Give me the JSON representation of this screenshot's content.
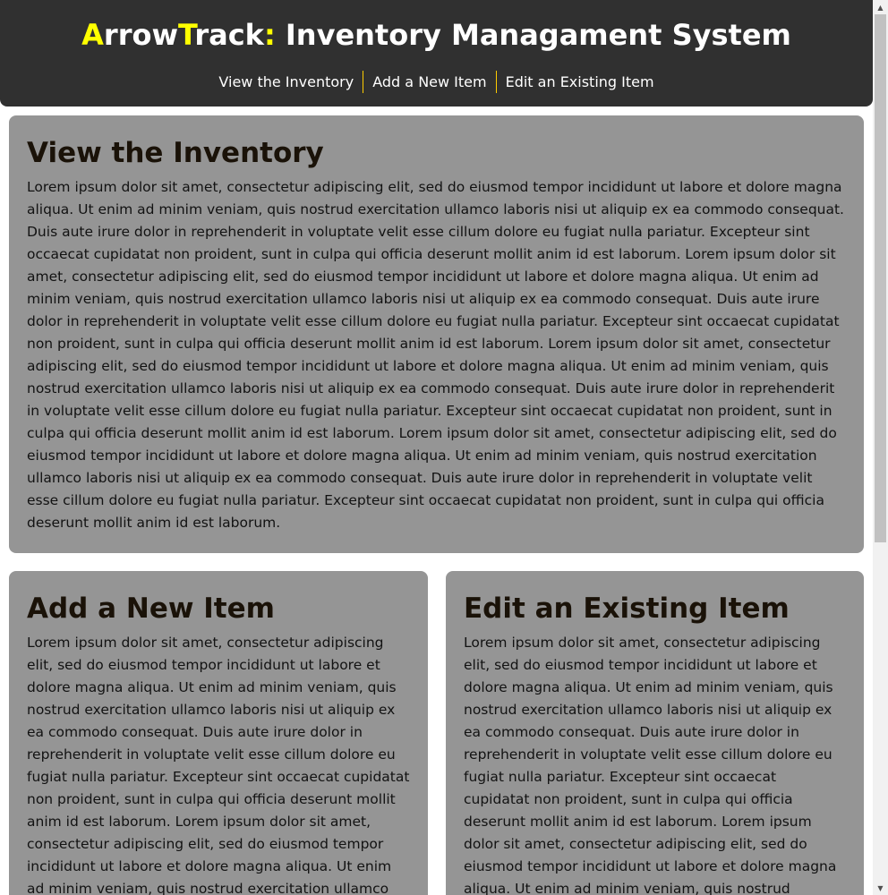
{
  "header": {
    "title_parts": [
      {
        "text": "A",
        "accent": true
      },
      {
        "text": "rrow",
        "accent": false
      },
      {
        "text": "T",
        "accent": true
      },
      {
        "text": "rack",
        "accent": false
      },
      {
        "text": ":",
        "accent": true
      },
      {
        "text": " Inventory Managament System",
        "accent": false
      }
    ],
    "nav": [
      {
        "label": "View the Inventory"
      },
      {
        "label": "Add a New Item"
      },
      {
        "label": "Edit an Existing Item"
      }
    ]
  },
  "sections": {
    "view": {
      "heading": "View the Inventory",
      "body": "Lorem ipsum dolor sit amet, consectetur adipiscing elit, sed do eiusmod tempor incididunt ut labore et dolore magna aliqua. Ut enim ad minim veniam, quis nostrud exercitation ullamco laboris nisi ut aliquip ex ea commodo consequat. Duis aute irure dolor in reprehenderit in voluptate velit esse cillum dolore eu fugiat nulla pariatur. Excepteur sint occaecat cupidatat non proident, sunt in culpa qui officia deserunt mollit anim id est laborum. Lorem ipsum dolor sit amet, consectetur adipiscing elit, sed do eiusmod tempor incididunt ut labore et dolore magna aliqua. Ut enim ad minim veniam, quis nostrud exercitation ullamco laboris nisi ut aliquip ex ea commodo consequat. Duis aute irure dolor in reprehenderit in voluptate velit esse cillum dolore eu fugiat nulla pariatur. Excepteur sint occaecat cupidatat non proident, sunt in culpa qui officia deserunt mollit anim id est laborum. Lorem ipsum dolor sit amet, consectetur adipiscing elit, sed do eiusmod tempor incididunt ut labore et dolore magna aliqua. Ut enim ad minim veniam, quis nostrud exercitation ullamco laboris nisi ut aliquip ex ea commodo consequat. Duis aute irure dolor in reprehenderit in voluptate velit esse cillum dolore eu fugiat nulla pariatur. Excepteur sint occaecat cupidatat non proident, sunt in culpa qui officia deserunt mollit anim id est laborum. Lorem ipsum dolor sit amet, consectetur adipiscing elit, sed do eiusmod tempor incididunt ut labore et dolore magna aliqua. Ut enim ad minim veniam, quis nostrud exercitation ullamco laboris nisi ut aliquip ex ea commodo consequat. Duis aute irure dolor in reprehenderit in voluptate velit esse cillum dolore eu fugiat nulla pariatur. Excepteur sint occaecat cupidatat non proident, sunt in culpa qui officia deserunt mollit anim id est laborum."
    },
    "add": {
      "heading": "Add a New Item",
      "body": "Lorem ipsum dolor sit amet, consectetur adipiscing elit, sed do eiusmod tempor incididunt ut labore et dolore magna aliqua. Ut enim ad minim veniam, quis nostrud exercitation ullamco laboris nisi ut aliquip ex ea commodo consequat. Duis aute irure dolor in reprehenderit in voluptate velit esse cillum dolore eu fugiat nulla pariatur. Excepteur sint occaecat cupidatat non proident, sunt in culpa qui officia deserunt mollit anim id est laborum. Lorem ipsum dolor sit amet, consectetur adipiscing elit, sed do eiusmod tempor incididunt ut labore et dolore magna aliqua. Ut enim ad minim veniam, quis nostrud exercitation ullamco"
    },
    "edit": {
      "heading": "Edit an Existing Item",
      "body": "Lorem ipsum dolor sit amet, consectetur adipiscing elit, sed do eiusmod tempor incididunt ut labore et dolore magna aliqua. Ut enim ad minim veniam, quis nostrud exercitation ullamco laboris nisi ut aliquip ex ea commodo consequat. Duis aute irure dolor in reprehenderit in voluptate velit esse cillum dolore eu fugiat nulla pariatur. Excepteur sint occaecat cupidatat non proident, sunt in culpa qui officia deserunt mollit anim id est laborum. Lorem ipsum dolor sit amet, consectetur adipiscing elit, sed do eiusmod tempor incididunt ut labore et dolore magna aliqua. Ut enim ad minim veniam, quis nostrud exercitation ullamco"
    }
  },
  "colors": {
    "header_bg": "#303030",
    "accent": "#ffff00",
    "nav_separator": "#ffcc00",
    "card_bg": "#959595"
  }
}
